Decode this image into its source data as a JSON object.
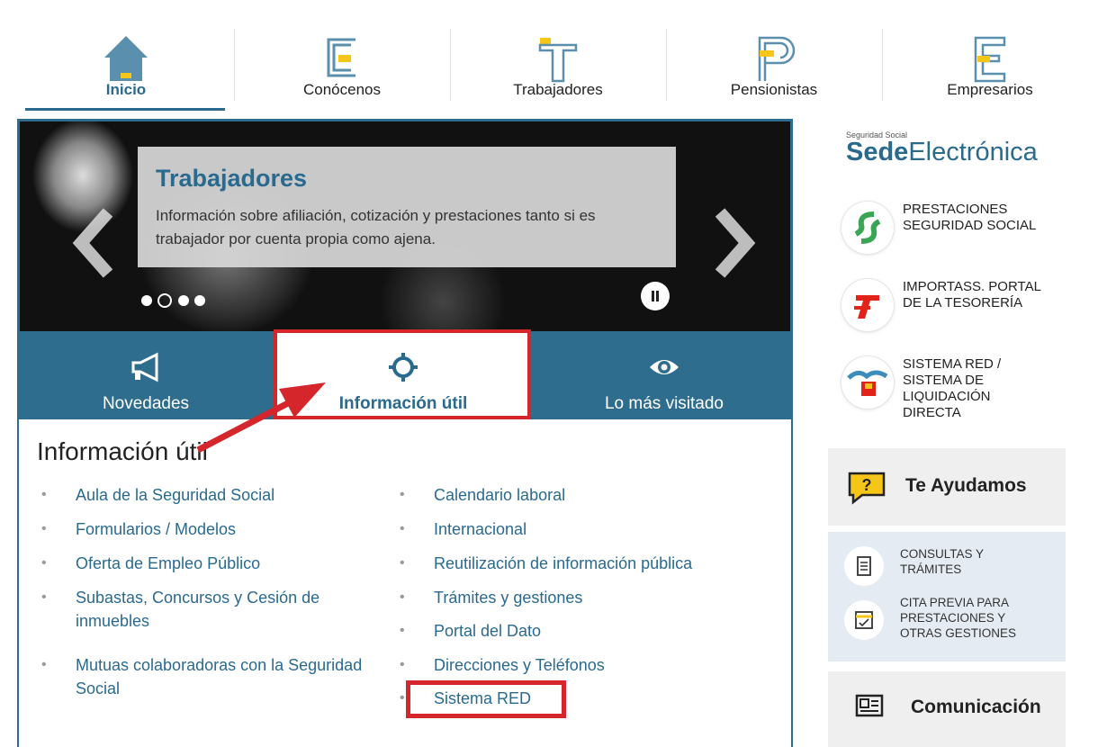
{
  "nav": {
    "items": [
      {
        "label": "Inicio",
        "icon": "home-icon",
        "active": true
      },
      {
        "label": "Conócenos",
        "icon": "letter-c-icon"
      },
      {
        "label": "Trabajadores",
        "icon": "letter-t-icon"
      },
      {
        "label": "Pensionistas",
        "icon": "letter-p-icon"
      },
      {
        "label": "Empresarios",
        "icon": "letter-e-icon"
      }
    ]
  },
  "carousel": {
    "title": "Trabajadores",
    "description": "Información sobre afiliación, cotización y prestaciones tanto si es trabajador por cuenta propia como ajena."
  },
  "tabs": [
    {
      "label": "Novedades",
      "icon": "megaphone-icon"
    },
    {
      "label": "Información útil",
      "icon": "crosshair-icon",
      "active": true
    },
    {
      "label": "Lo más visitado",
      "icon": "eye-icon"
    }
  ],
  "content": {
    "heading": "Información útil",
    "left_links": [
      "Aula de la Seguridad Social",
      "Formularios / Modelos",
      "Oferta de Empleo Público",
      "Subastas, Concursos y Cesión de inmuebles",
      "Mutuas colaboradoras con la Seguridad Social"
    ],
    "right_links": [
      "Calendario laboral",
      "Internacional",
      "Reutilización de información pública",
      "Trámites y gestiones",
      "Portal del Dato",
      "Direcciones y Teléfonos",
      "Sistema RED"
    ]
  },
  "sidebar": {
    "sede_small": "Seguridad Social",
    "sede_bold": "Sede",
    "sede_light": "Electrónica",
    "links": [
      {
        "line1": "PRESTACIONES",
        "line2": "SEGURIDAD SOCIAL",
        "icon": "prestaciones-logo-icon"
      },
      {
        "line1": "IMPORTASS. PORTAL",
        "line2": "DE LA TESORERÍA",
        "icon": "importass-logo-icon"
      },
      {
        "line1": "SISTEMA RED /",
        "line2": "SISTEMA DE",
        "line3": "LIQUIDACIÓN",
        "line4": "DIRECTA",
        "icon": "sistema-red-logo-icon"
      }
    ],
    "help_title": "Te Ayudamos",
    "help_items": [
      {
        "line1": "CONSULTAS Y",
        "line2": "TRÁMITES",
        "icon": "document-icon"
      },
      {
        "line1": "CITA PREVIA PARA",
        "line2": "PRESTACIONES Y",
        "line3": "OTRAS GESTIONES",
        "icon": "calendar-icon"
      }
    ],
    "comm_title": "Comunicación"
  },
  "colors": {
    "accent": "#2f6d8f",
    "highlight": "#d4262b",
    "yellow": "#f5c518"
  }
}
